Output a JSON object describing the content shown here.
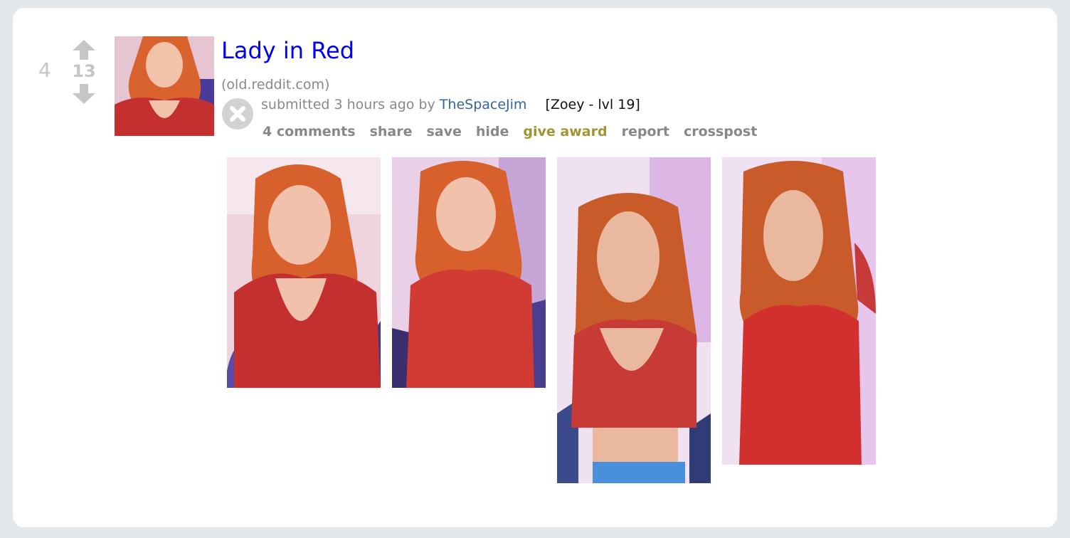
{
  "post": {
    "rank": "4",
    "score": "13",
    "title": "Lady in Red",
    "domain": "(old.reddit.com)",
    "tagline": {
      "submitted": "submitted 3 hours ago by",
      "author": "TheSpaceJim",
      "flair": "[Zoey - lvl 19]"
    },
    "buttons": {
      "comments": "4 comments",
      "share": "share",
      "save": "save",
      "hide": "hide",
      "give_award": "give award",
      "report": "report",
      "crosspost": "crosspost"
    }
  },
  "icons": {
    "upvote": "up-arrow-icon",
    "downvote": "down-arrow-icon",
    "close": "close-icon"
  },
  "colors": {
    "title_link": "#0000ee",
    "author_link": "#336699",
    "award": "#a39433",
    "muted": "#888888",
    "vote_arrow": "#c6c6c6",
    "background": "#e3e8ec"
  }
}
